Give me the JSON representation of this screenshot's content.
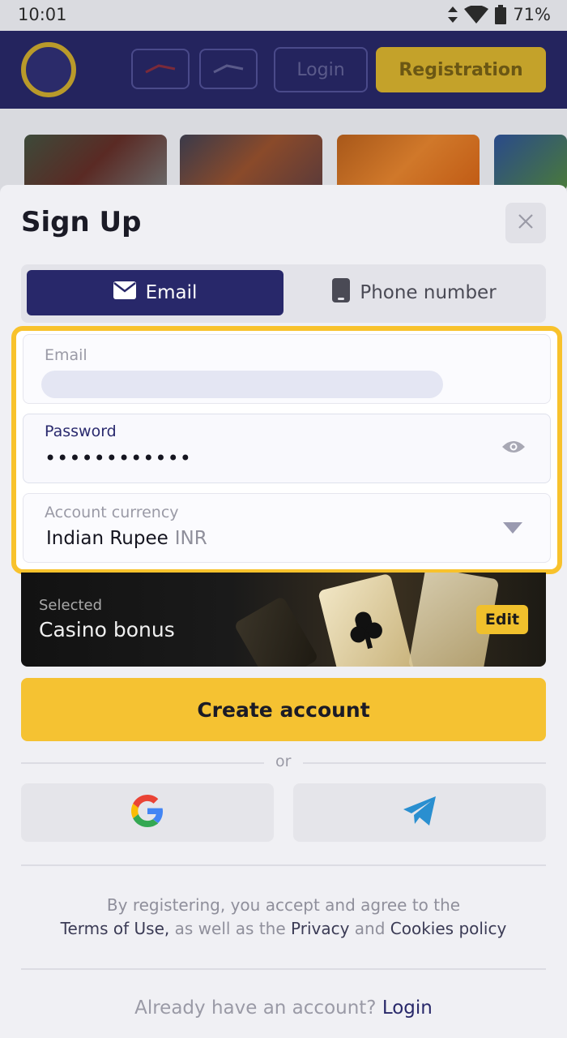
{
  "status_bar": {
    "time": "10:01",
    "battery": "71%"
  },
  "app_header": {
    "login_label": "Login",
    "registration_label": "Registration"
  },
  "modal": {
    "title": "Sign Up",
    "tabs": [
      {
        "label": "Email",
        "icon": "envelope-icon",
        "active": true
      },
      {
        "label": "Phone number",
        "icon": "phone-icon",
        "active": false
      }
    ],
    "fields": {
      "email": {
        "label": "Email"
      },
      "password": {
        "label": "Password",
        "value": "••••••••••••"
      },
      "currency": {
        "label": "Account currency",
        "value": "Indian Rupee",
        "code": "INR"
      }
    },
    "bonus": {
      "selected_label": "Selected",
      "name": "Casino bonus",
      "edit_label": "Edit"
    },
    "create_button": "Create account",
    "or_label": "or",
    "social": [
      {
        "icon": "google-icon"
      },
      {
        "icon": "telegram-icon"
      }
    ],
    "terms": {
      "line1": "By registering, you accept and agree to the",
      "terms_link": "Terms of Use,",
      "middle": " as well as the ",
      "privacy_link": "Privacy",
      "and": " and ",
      "cookies_link": "Cookies policy"
    },
    "login_prompt": {
      "text": "Already have an account?",
      "link": "Login"
    }
  },
  "colors": {
    "accent_navy": "#28286a",
    "accent_yellow": "#f5c232",
    "highlight_border": "#f8c22c"
  }
}
